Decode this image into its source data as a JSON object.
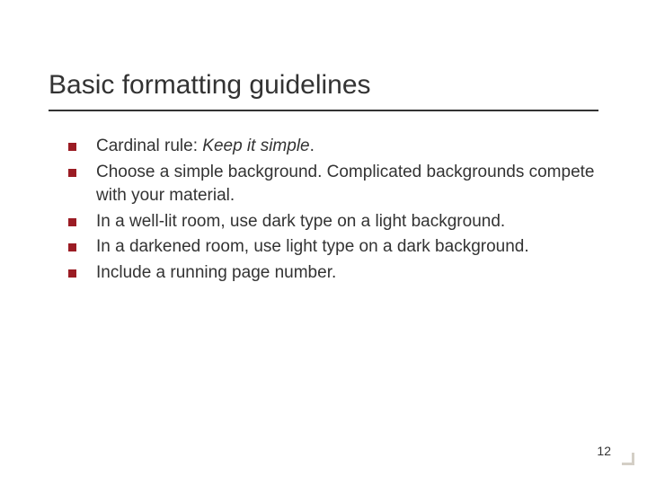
{
  "title": "Basic formatting guidelines",
  "bullets": [
    {
      "pre": "Cardinal rule: ",
      "em": "Keep it simple",
      "post": "."
    },
    {
      "pre": "Choose a simple background. Complicated backgrounds compete with your material.",
      "em": "",
      "post": ""
    },
    {
      "pre": "In a well-lit room, use dark type on a light background.",
      "em": "",
      "post": ""
    },
    {
      "pre": "In a darkened room, use light type on a dark background.",
      "em": "",
      "post": ""
    },
    {
      "pre": "Include a running page number.",
      "em": "",
      "post": ""
    }
  ],
  "page_number": "12"
}
